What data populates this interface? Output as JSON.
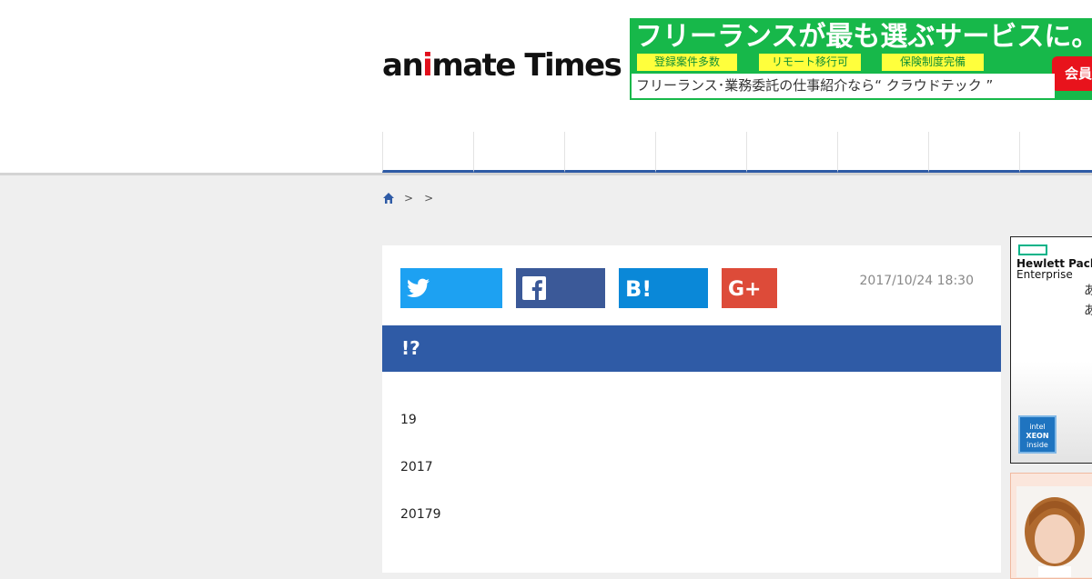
{
  "logo": {
    "prefix": "an",
    "i": "i",
    "suffix": "mate Times"
  },
  "ad_banner": {
    "headline": "フリーランスが最も選ぶサービスに。",
    "tags": [
      "登録案件多数",
      "リモート移行可",
      "保険制度完備"
    ],
    "button_label": "会員",
    "subline": "フリーランス･業務委託の仕事紹介なら“ クラウドテック ”"
  },
  "breadcrumb": {
    "separators": [
      ">",
      ">"
    ]
  },
  "article": {
    "date": "2017/10/24 18:30",
    "title": "!?",
    "paragraphs": [
      "19",
      "2017",
      "20179"
    ]
  },
  "share": {
    "twitter": "twitter-icon",
    "facebook": "facebook-icon",
    "hatena": "hatena-bookmark-icon",
    "google_plus": "google-plus-icon"
  },
  "side_ad": {
    "brand_line1": "Hewlett Packard",
    "brand_line2": "Enterprise",
    "text_lines": [
      "あ",
      "あ"
    ],
    "badge_line1": "intel",
    "badge_line2": "XEON",
    "badge_line3": "inside"
  },
  "colors": {
    "brand_blue": "#2f5ba6",
    "twitter": "#1da1f2",
    "facebook": "#3b5998",
    "hatena": "#0a88d8",
    "google_plus": "#dd4b39",
    "ad_green": "#17b84a"
  }
}
